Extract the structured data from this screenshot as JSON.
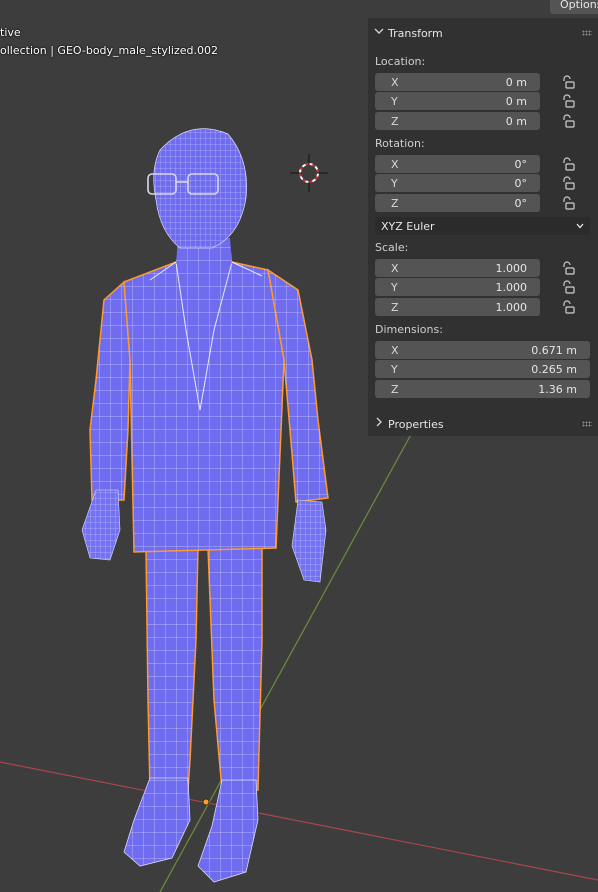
{
  "viewport": {
    "mode_label": "tive",
    "object_label": "ollection | GEO-body_male_stylized.002",
    "options_label": "Options"
  },
  "npanel": {
    "transform_title": "Transform",
    "location": {
      "label": "Location:",
      "x": {
        "axis": "X",
        "value": "0 m"
      },
      "y": {
        "axis": "Y",
        "value": "0 m"
      },
      "z": {
        "axis": "Z",
        "value": "0 m"
      }
    },
    "rotation": {
      "label": "Rotation:",
      "x": {
        "axis": "X",
        "value": "0°"
      },
      "y": {
        "axis": "Y",
        "value": "0°"
      },
      "z": {
        "axis": "Z",
        "value": "0°"
      },
      "mode": "XYZ Euler"
    },
    "scale": {
      "label": "Scale:",
      "x": {
        "axis": "X",
        "value": "1.000"
      },
      "y": {
        "axis": "Y",
        "value": "1.000"
      },
      "z": {
        "axis": "Z",
        "value": "1.000"
      }
    },
    "dimensions": {
      "label": "Dimensions:",
      "x": {
        "axis": "X",
        "value": "0.671 m"
      },
      "y": {
        "axis": "Y",
        "value": "0.265 m"
      },
      "z": {
        "axis": "Z",
        "value": "1.36 m"
      }
    },
    "properties_title": "Properties"
  },
  "colors": {
    "background": "#3d3d3d",
    "mesh_fill": "#6f6cf0",
    "wire": "#d9d9ff",
    "selection_outline": "#ff9a2a",
    "x_axis": "#a8454d",
    "y_axis": "#6c8e3a"
  }
}
